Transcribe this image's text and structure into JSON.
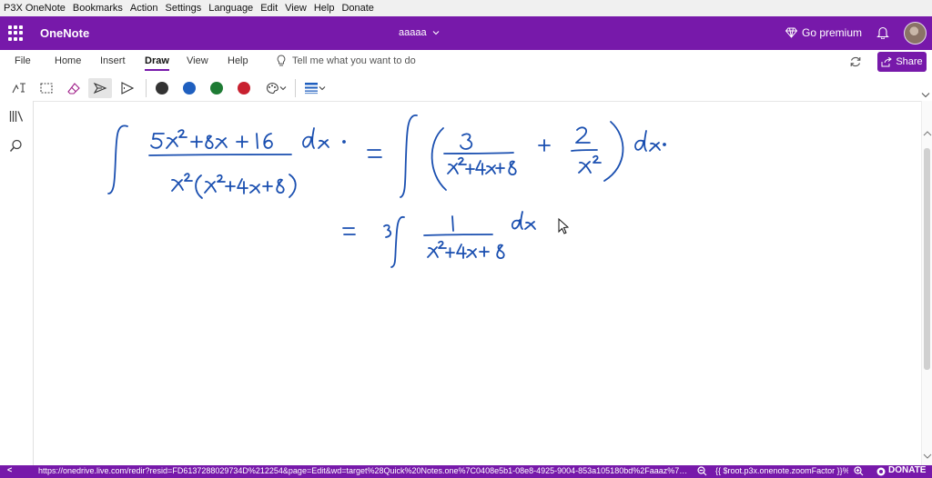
{
  "menubar": [
    "P3X OneNote",
    "Bookmarks",
    "Action",
    "Settings",
    "Language",
    "Edit",
    "View",
    "Help",
    "Donate"
  ],
  "header": {
    "app_name": "OneNote",
    "notebook": "aaaaa",
    "premium": "Go premium"
  },
  "tabs": [
    "File",
    "Home",
    "Insert",
    "Draw",
    "View",
    "Help"
  ],
  "active_tab": "Draw",
  "tell_me_placeholder": "Tell me what you want to do",
  "share_label": "Share",
  "pens": [
    "#333333",
    "#1f5fbf",
    "#1e7b34",
    "#c8202f"
  ],
  "ink_color": "#1a4fb0",
  "brand_color": "#7719aa",
  "status": {
    "left_arrow": "<",
    "url": "https://onedrive.live.com/redir?resid=FD6137288029734D%212254&page=Edit&wd=target%28Quick%20Notes.one%7C0408e5b1-08e8-4925-9004-853a105180bd%2Faaaz%7C85...",
    "zoom_factor": "{{ $root.p3x.onenote.zoomFactor }}%",
    "donate": "DONATE"
  }
}
